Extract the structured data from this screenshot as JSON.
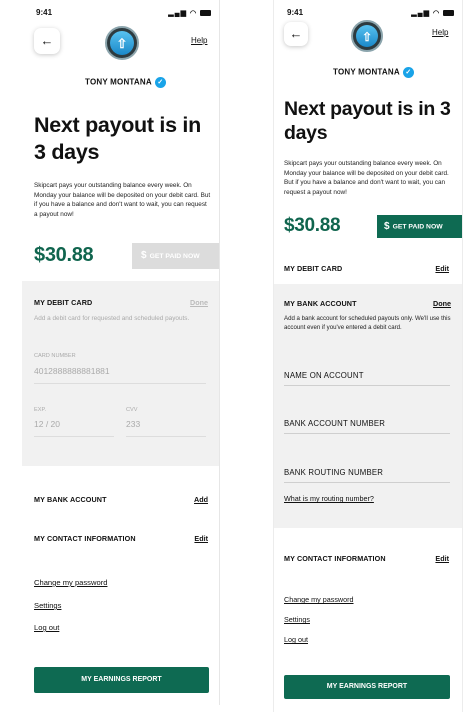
{
  "status_bar": {
    "time": "9:41"
  },
  "nav": {
    "back_icon": "←",
    "help_label": "Help"
  },
  "user": {
    "name": "TONY MONTANA"
  },
  "headline": "Next payout is in 3 days",
  "description": "Skipcart pays your outstanding balance every week. On Monday your balance will be deposited on your debit card. But if you have a balance and don't want to wait, you can request a payout now!",
  "balance": "$30.88",
  "get_paid_label": "GET PAID NOW",
  "get_paid_icon": "$",
  "left_screen": {
    "debit_card": {
      "title": "MY DEBIT CARD",
      "action": "Done",
      "description": "Add a debit card for requested and scheduled payouts.",
      "card_number_label": "CARD NUMBER",
      "card_number": "4012888888881881",
      "exp_label": "EXP.",
      "exp_value": "12 / 20",
      "cvv_label": "CVV",
      "cvv_value": "233"
    },
    "bank_account": {
      "title": "MY BANK ACCOUNT",
      "action": "Add"
    },
    "contact": {
      "title": "MY CONTACT INFORMATION",
      "action": "Edit"
    }
  },
  "right_screen": {
    "debit_card": {
      "title": "MY DEBIT CARD",
      "action": "Edit"
    },
    "bank_account": {
      "title": "MY BANK ACCOUNT",
      "action": "Done",
      "description": "Add a bank account for scheduled payouts only. We'll use this account even if you've entered a debit card.",
      "name_label": "NAME ON ACCOUNT",
      "account_number_label": "BANK ACCOUNT NUMBER",
      "routing_number_label": "BANK ROUTING NUMBER",
      "routing_help_link": "What is my routing number?"
    },
    "contact": {
      "title": "MY CONTACT INFORMATION",
      "action": "Edit"
    }
  },
  "links": {
    "change_password": "Change my password",
    "settings": "Settings",
    "logout": "Log out"
  },
  "earnings_button": "MY EARNINGS REPORT",
  "colors": {
    "brand_green": "#10654e",
    "button_green": "#0e6a52",
    "verified_blue": "#19a3e8",
    "disabled_button": "#dcdcdc",
    "panel_gray": "#f1f1f1"
  }
}
